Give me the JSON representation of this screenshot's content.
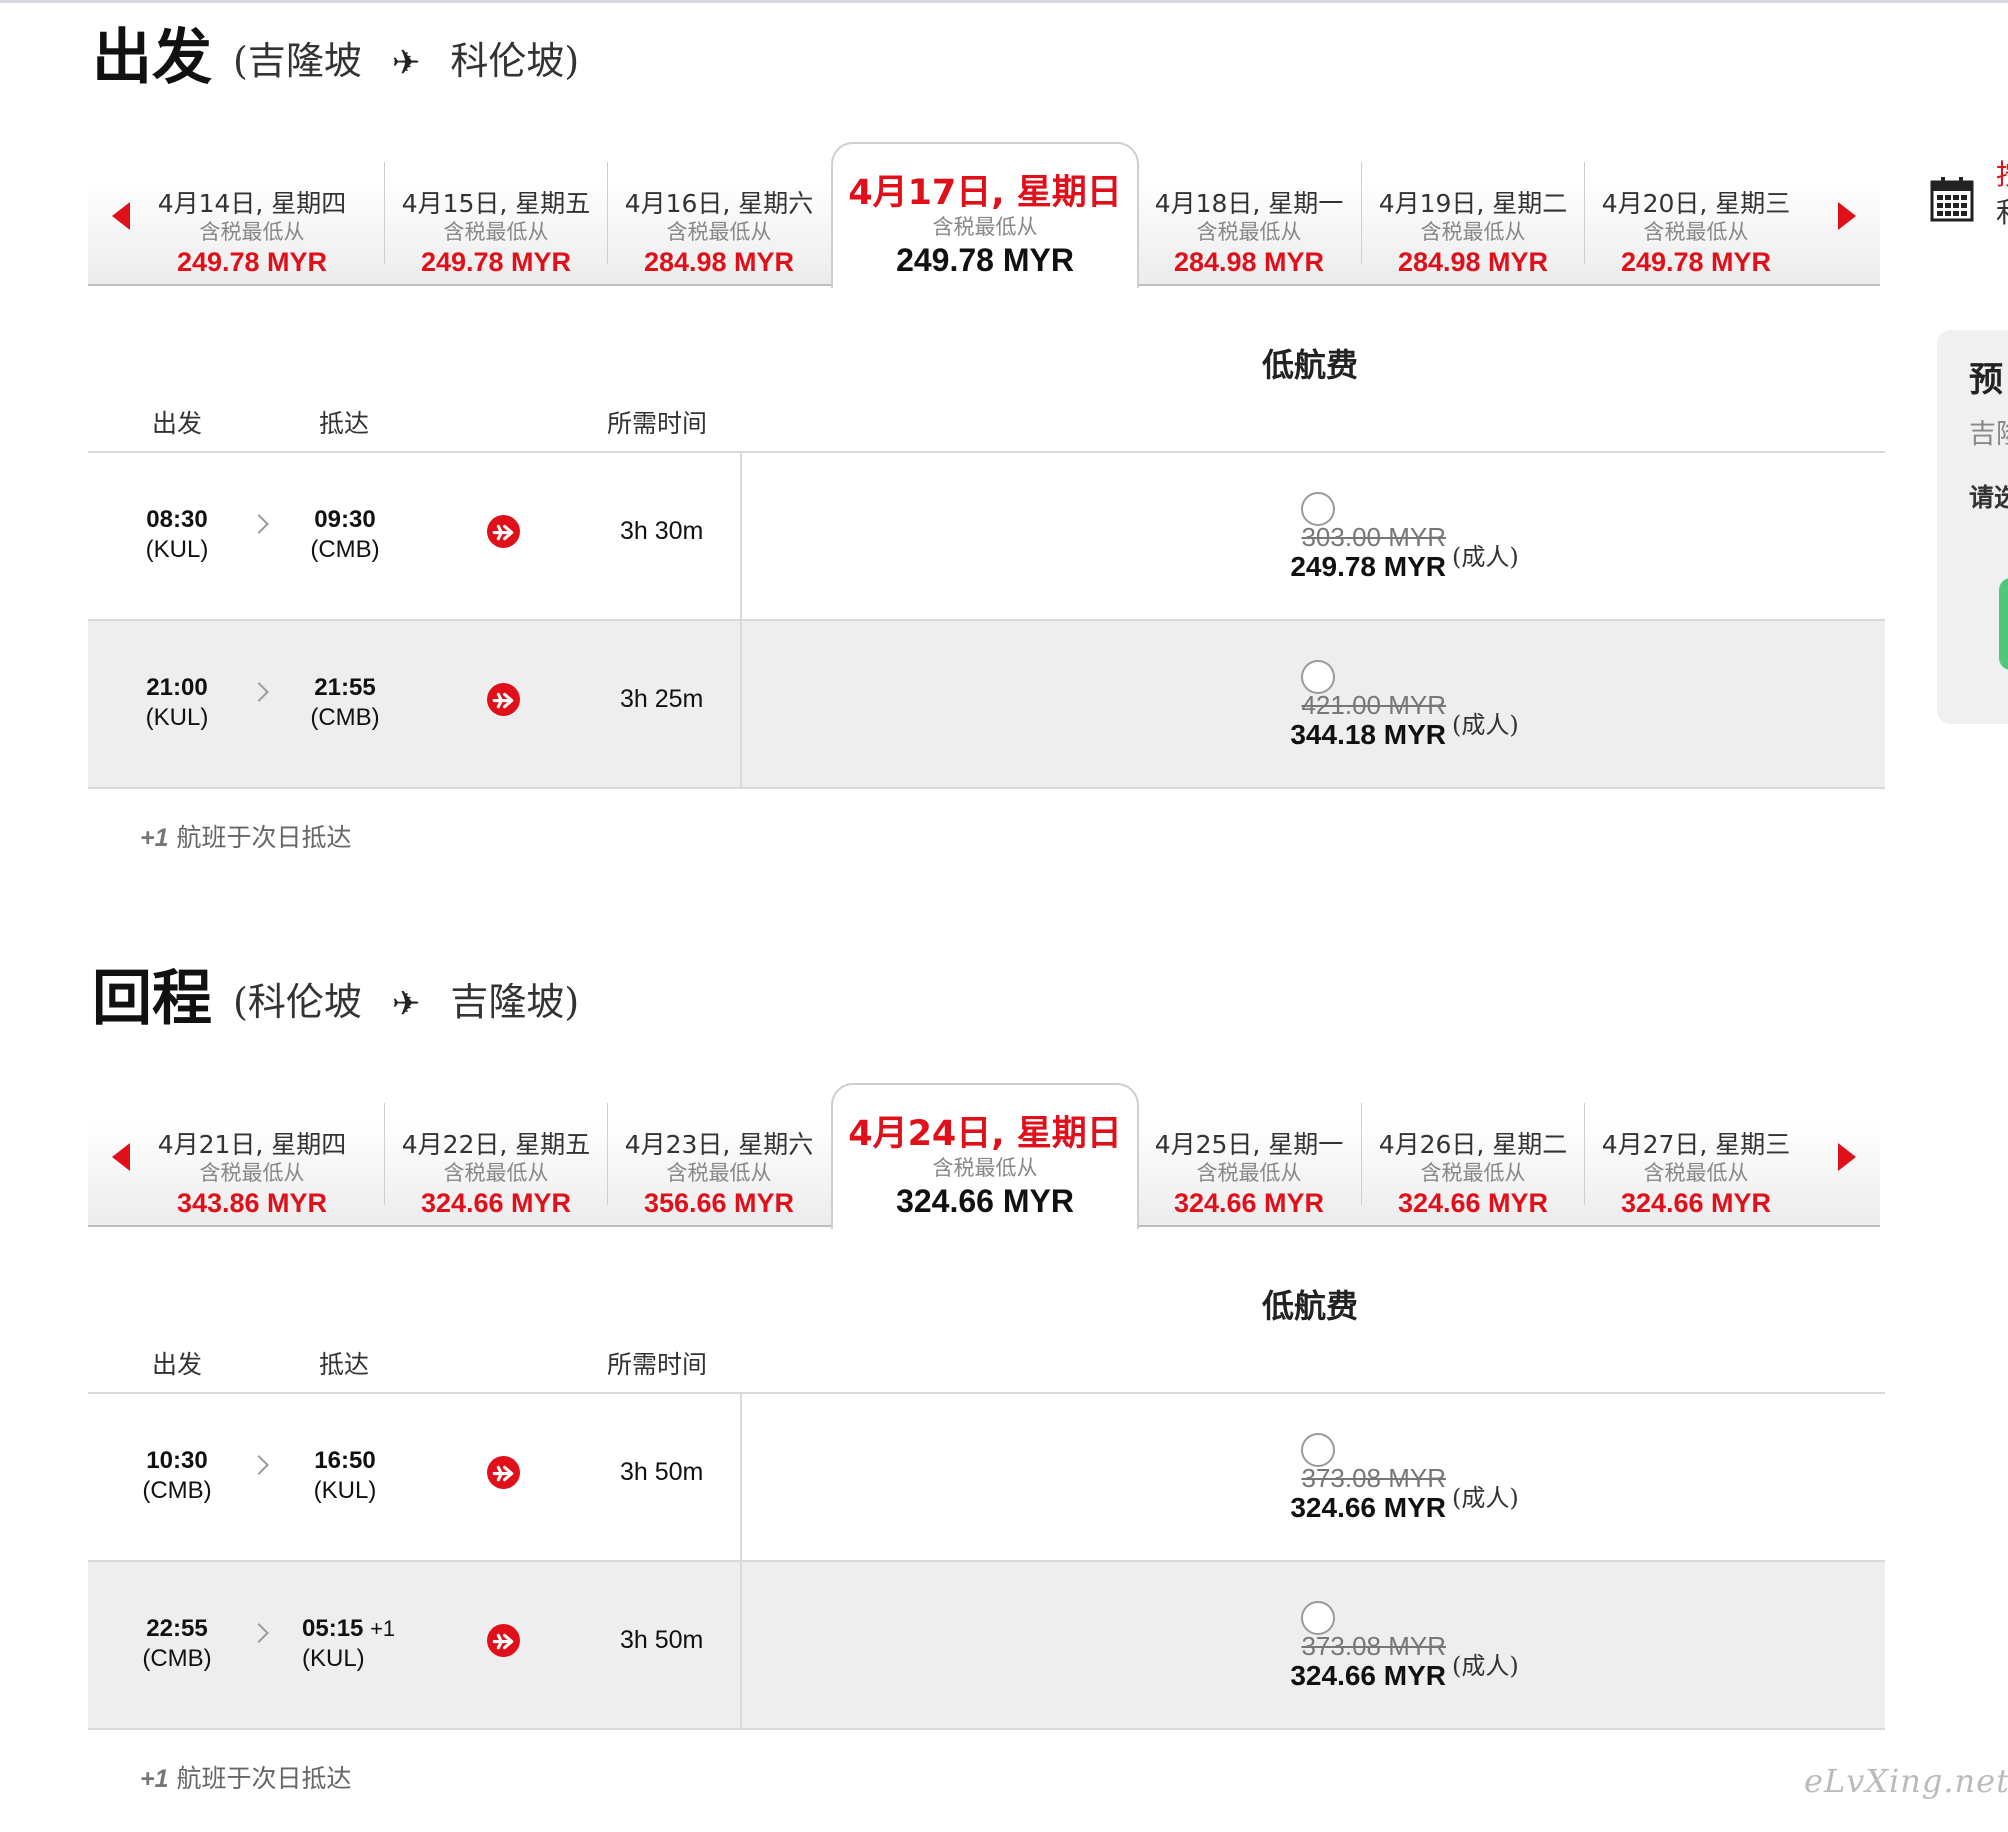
{
  "departure": {
    "heading": "出发",
    "route_from": "(吉隆坡",
    "route_to": "科伦坡)",
    "date_tabs": [
      {
        "date": "4月14日, 星期四",
        "sub": "含税最低从",
        "price": "249.78 MYR"
      },
      {
        "date": "4月15日, 星期五",
        "sub": "含税最低从",
        "price": "249.78 MYR"
      },
      {
        "date": "4月16日, 星期六",
        "sub": "含税最低从",
        "price": "284.98 MYR"
      },
      {
        "date": "4月17日, 星期日",
        "sub": "含税最低从",
        "price": "249.78 MYR"
      },
      {
        "date": "4月18日, 星期一",
        "sub": "含税最低从",
        "price": "284.98 MYR"
      },
      {
        "date": "4月19日, 星期二",
        "sub": "含税最低从",
        "price": "284.98 MYR"
      },
      {
        "date": "4月20日, 星期三",
        "sub": "含税最低从",
        "price": "249.78 MYR"
      }
    ],
    "fare_header": "低航费",
    "col_depart": "出发",
    "col_arrive": "抵达",
    "col_duration": "所需时间",
    "flights": [
      {
        "dep_time": "08:30",
        "dep_code": "(KUL)",
        "arr_time": "09:30",
        "arr_next_day": "",
        "arr_code": "(CMB)",
        "duration": "3h 30m",
        "old_price": "303.00 MYR",
        "price": "249.78 MYR",
        "pax": "(成人)"
      },
      {
        "dep_time": "21:00",
        "dep_code": "(KUL)",
        "arr_time": "21:55",
        "arr_next_day": "",
        "arr_code": "(CMB)",
        "duration": "3h 25m",
        "old_price": "421.00 MYR",
        "price": "344.18 MYR",
        "pax": "(成人)"
      }
    ],
    "footnote_mark": "+1",
    "footnote_text": " 航班于次日抵达"
  },
  "return": {
    "heading": "回程",
    "route_from": "(科伦坡",
    "route_to": "吉隆坡)",
    "date_tabs": [
      {
        "date": "4月21日, 星期四",
        "sub": "含税最低从",
        "price": "343.86 MYR"
      },
      {
        "date": "4月22日, 星期五",
        "sub": "含税最低从",
        "price": "324.66 MYR"
      },
      {
        "date": "4月23日, 星期六",
        "sub": "含税最低从",
        "price": "356.66 MYR"
      },
      {
        "date": "4月24日, 星期日",
        "sub": "含税最低从",
        "price": "324.66 MYR"
      },
      {
        "date": "4月25日, 星期一",
        "sub": "含税最低从",
        "price": "324.66 MYR"
      },
      {
        "date": "4月26日, 星期二",
        "sub": "含税最低从",
        "price": "324.66 MYR"
      },
      {
        "date": "4月27日, 星期三",
        "sub": "含税最低从",
        "price": "324.66 MYR"
      }
    ],
    "fare_header": "低航费",
    "col_depart": "出发",
    "col_arrive": "抵达",
    "col_duration": "所需时间",
    "flights": [
      {
        "dep_time": "10:30",
        "dep_code": "(CMB)",
        "arr_time": "16:50",
        "arr_next_day": "",
        "arr_code": "(KUL)",
        "duration": "3h 50m",
        "old_price": "373.08 MYR",
        "price": "324.66 MYR",
        "pax": "(成人)"
      },
      {
        "dep_time": "22:55",
        "dep_code": "(CMB)",
        "arr_time": "05:15",
        "arr_next_day": "+1",
        "arr_code": "(KUL)",
        "duration": "3h 50m",
        "old_price": "373.08 MYR",
        "price": "324.66 MYR",
        "pax": "(成人)"
      }
    ],
    "footnote_mark": "+1",
    "footnote_text": " 航班于次日抵达"
  },
  "side": {
    "top_red": "按",
    "top_dark": "利",
    "summary_title": "预",
    "summary_route": "吉隆",
    "summary_note": "请选"
  },
  "watermark": "eLvXing.net",
  "colors": {
    "accent": "#e0101a",
    "book_button": "#50c77a"
  }
}
